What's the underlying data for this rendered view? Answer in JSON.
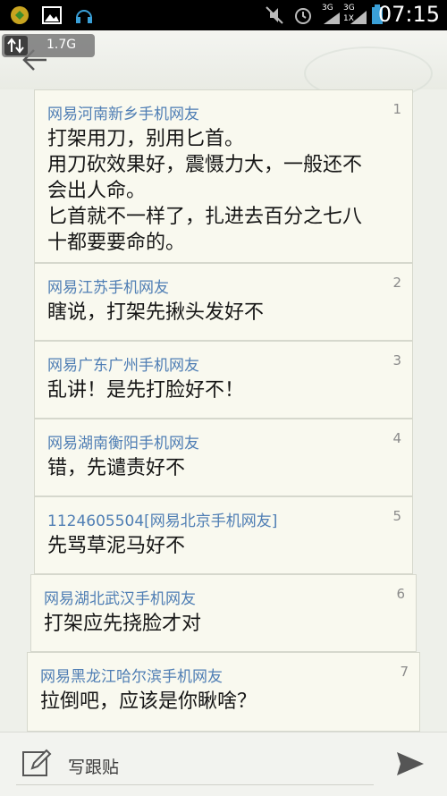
{
  "status_bar": {
    "time": "07:15",
    "network_a": "3G",
    "network_b": "3G",
    "network_c": "1X"
  },
  "header": {
    "speed": "1.7G"
  },
  "posts": [
    {
      "author": "网易河南新乡手机网友",
      "floor": "1",
      "lines": [
        "打架用刀，别用匕首。",
        "用刀砍效果好，震慑力大，一般还不",
        "会出人命。",
        "匕首就不一样了，扎进去百分之七八",
        "十都要要命的。"
      ]
    },
    {
      "author": "网易江苏手机网友",
      "floor": "2",
      "lines": [
        "瞎说，打架先揪头发好不"
      ]
    },
    {
      "author": "网易广东广州手机网友",
      "floor": "3",
      "lines": [
        "乱讲！是先打脸好不！"
      ]
    },
    {
      "author": "网易湖南衡阳手机网友",
      "floor": "4",
      "lines": [
        "错，先谴责好不"
      ]
    },
    {
      "author": "1124605504[网易北京手机网友]",
      "floor": "5",
      "lines": [
        "先骂草泥马好不"
      ]
    },
    {
      "author": "网易湖北武汉手机网友",
      "floor": "6",
      "lines": [
        "打架应先挠脸才对"
      ]
    },
    {
      "author": "网易黑龙江哈尔滨手机网友",
      "floor": "7",
      "lines": [
        "拉倒吧，应该是你瞅啥？"
      ]
    }
  ],
  "bottom_bar": {
    "compose_label": "写跟贴"
  }
}
